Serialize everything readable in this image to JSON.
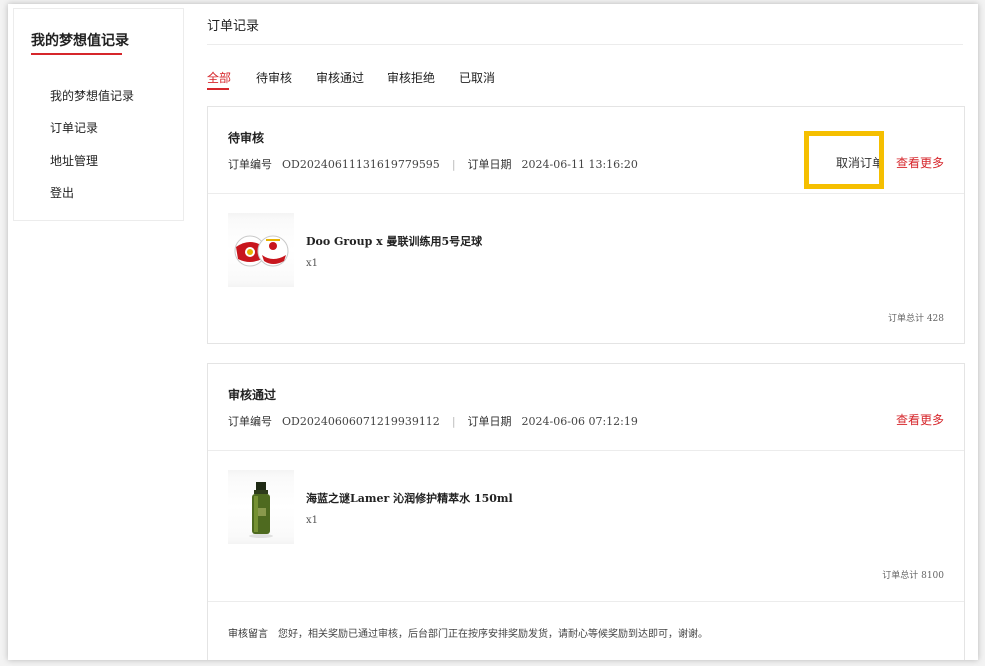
{
  "sidebar": {
    "title": "我的梦想值记录",
    "items": [
      {
        "label": "我的梦想值记录"
      },
      {
        "label": "订单记录"
      },
      {
        "label": "地址管理"
      },
      {
        "label": "登出"
      }
    ]
  },
  "main": {
    "title": "订单记录",
    "tabs": [
      {
        "label": "全部",
        "active": true
      },
      {
        "label": "待审核"
      },
      {
        "label": "审核通过"
      },
      {
        "label": "审核拒绝"
      },
      {
        "label": "已取消"
      }
    ]
  },
  "labels": {
    "order_no": "订单编号",
    "order_date": "订单日期",
    "separator": "|",
    "cancel": "取消订单",
    "more": "查看更多",
    "remark": "审核留言"
  },
  "orders": [
    {
      "status": "待审核",
      "order_no": "OD20240611131619779595",
      "date": "2024-06-11 13:16:20",
      "product": "Doo Group x 曼联训练用5号足球",
      "qty": "x1",
      "total": "订单总计 428"
    },
    {
      "status": "审核通过",
      "order_no": "OD20240606071219939112",
      "date": "2024-06-06 07:12:19",
      "product": "海蓝之谜Lamer 沁润修护精萃水 150ml",
      "qty": "x1",
      "total": "订单总计 8100",
      "remark": "您好，相关奖励已通过审核，后台部门正在按序安排奖励发货，请耐心等候奖励到达即可，谢谢。"
    }
  ],
  "colors": {
    "accent": "#d6262b",
    "highlight": "#f5bf00"
  },
  "icons": [
    "football-icon",
    "lamer-bottle-icon"
  ]
}
